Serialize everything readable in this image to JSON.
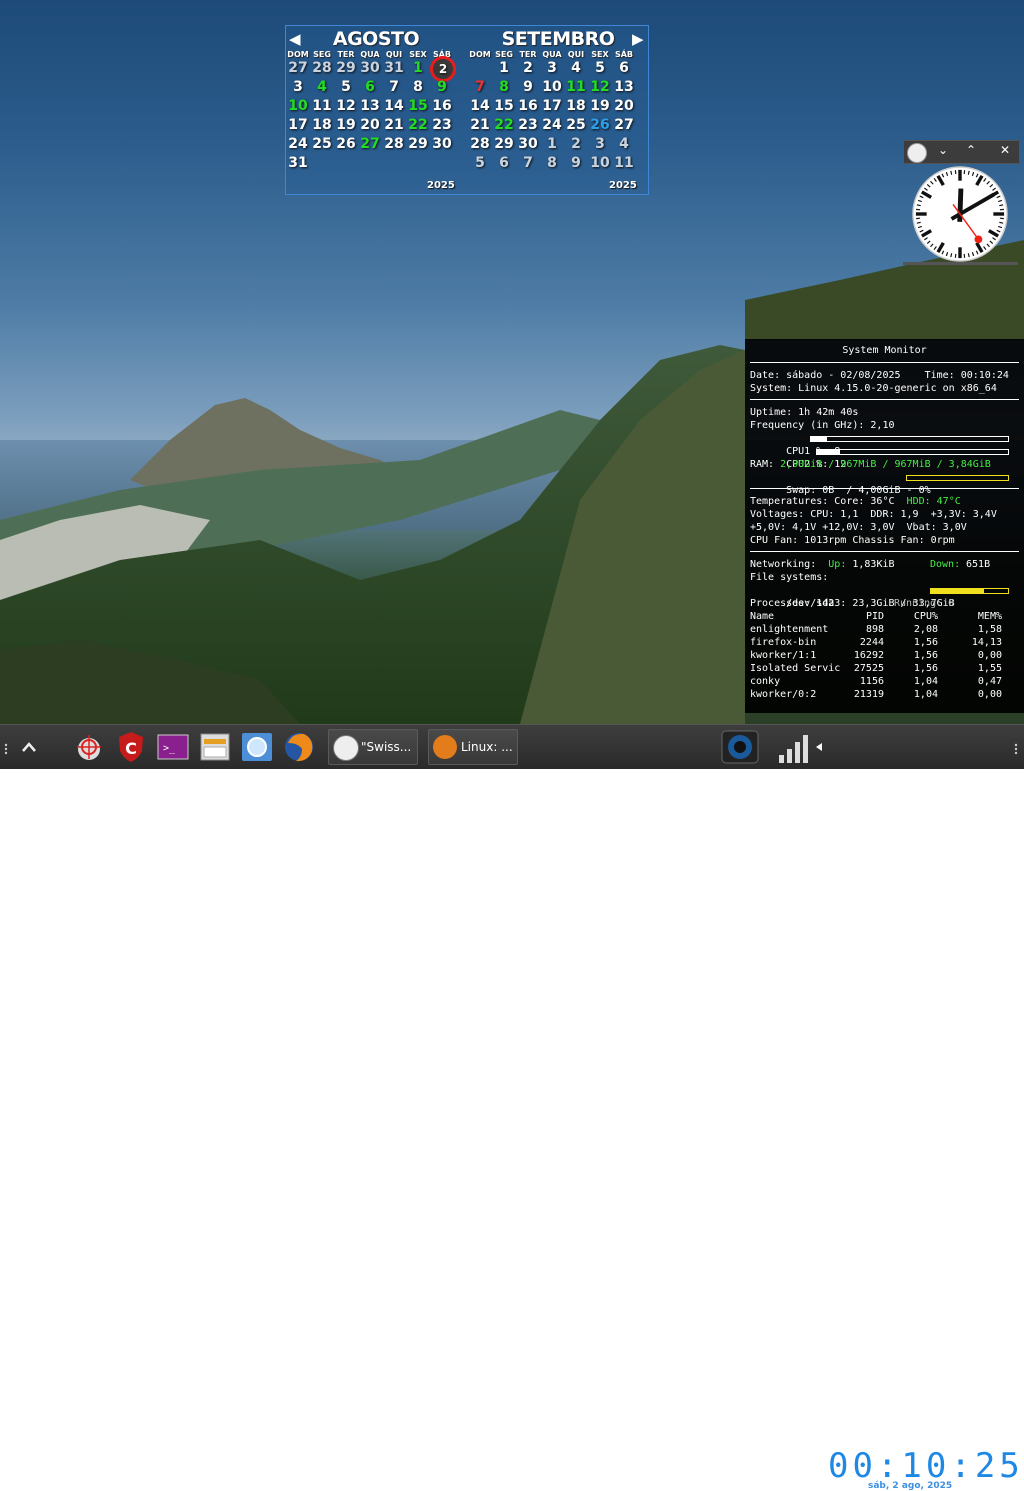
{
  "calendar": {
    "months": [
      {
        "name": "AGOSTO",
        "year": "2025",
        "weekdays": [
          "DOM",
          "SEG",
          "TER",
          "QUA",
          "QUI",
          "SEX",
          "SÁB"
        ],
        "weeks": [
          [
            {
              "d": "27",
              "s": "other"
            },
            {
              "d": "28",
              "s": "other"
            },
            {
              "d": "29",
              "s": "other"
            },
            {
              "d": "30",
              "s": "other"
            },
            {
              "d": "31",
              "s": "other"
            },
            {
              "d": "1",
              "s": "green"
            },
            {
              "d": "2",
              "s": "today"
            }
          ],
          [
            {
              "d": "3"
            },
            {
              "d": "4",
              "s": "green"
            },
            {
              "d": "5"
            },
            {
              "d": "6",
              "s": "green"
            },
            {
              "d": "7"
            },
            {
              "d": "8"
            },
            {
              "d": "9",
              "s": "green"
            }
          ],
          [
            {
              "d": "10",
              "s": "green"
            },
            {
              "d": "11"
            },
            {
              "d": "12"
            },
            {
              "d": "13"
            },
            {
              "d": "14"
            },
            {
              "d": "15",
              "s": "green"
            },
            {
              "d": "16"
            }
          ],
          [
            {
              "d": "17"
            },
            {
              "d": "18"
            },
            {
              "d": "19"
            },
            {
              "d": "20"
            },
            {
              "d": "21"
            },
            {
              "d": "22",
              "s": "green"
            },
            {
              "d": "23"
            }
          ],
          [
            {
              "d": "24"
            },
            {
              "d": "25"
            },
            {
              "d": "26"
            },
            {
              "d": "27",
              "s": "green"
            },
            {
              "d": "28"
            },
            {
              "d": "29"
            },
            {
              "d": "30"
            }
          ],
          [
            {
              "d": "31"
            },
            {
              "d": ""
            },
            {
              "d": ""
            },
            {
              "d": ""
            },
            {
              "d": ""
            },
            {
              "d": ""
            },
            {
              "d": ""
            }
          ]
        ]
      },
      {
        "name": "SETEMBRO",
        "year": "2025",
        "weekdays": [
          "DOM",
          "SEG",
          "TER",
          "QUA",
          "QUI",
          "SEX",
          "SÁB"
        ],
        "weeks": [
          [
            {
              "d": ""
            },
            {
              "d": "1"
            },
            {
              "d": "2"
            },
            {
              "d": "3"
            },
            {
              "d": "4"
            },
            {
              "d": "5"
            },
            {
              "d": "6"
            }
          ],
          [
            {
              "d": "7",
              "s": "red"
            },
            {
              "d": "8",
              "s": "green"
            },
            {
              "d": "9"
            },
            {
              "d": "10"
            },
            {
              "d": "11",
              "s": "green"
            },
            {
              "d": "12",
              "s": "green"
            },
            {
              "d": "13"
            }
          ],
          [
            {
              "d": "14"
            },
            {
              "d": "15"
            },
            {
              "d": "16"
            },
            {
              "d": "17"
            },
            {
              "d": "18"
            },
            {
              "d": "19"
            },
            {
              "d": "20"
            }
          ],
          [
            {
              "d": "21"
            },
            {
              "d": "22",
              "s": "green"
            },
            {
              "d": "23"
            },
            {
              "d": "24"
            },
            {
              "d": "25"
            },
            {
              "d": "26",
              "s": "blue"
            },
            {
              "d": "27"
            }
          ],
          [
            {
              "d": "28"
            },
            {
              "d": "29"
            },
            {
              "d": "30"
            },
            {
              "d": "1",
              "s": "other"
            },
            {
              "d": "2",
              "s": "other"
            },
            {
              "d": "3",
              "s": "other"
            },
            {
              "d": "4",
              "s": "other"
            }
          ],
          [
            {
              "d": "5",
              "s": "other"
            },
            {
              "d": "6",
              "s": "other"
            },
            {
              "d": "7",
              "s": "other"
            },
            {
              "d": "8",
              "s": "other"
            },
            {
              "d": "9",
              "s": "other"
            },
            {
              "d": "10",
              "s": "other"
            },
            {
              "d": "11",
              "s": "other"
            }
          ]
        ]
      }
    ]
  },
  "clock_widget": {
    "close_glyph": "✕",
    "minimize_glyph": "⌄",
    "maximize_glyph": "⌃",
    "hour_angle": 2,
    "minute_angle": 60,
    "second_angle": 144
  },
  "system_monitor": {
    "title": "System Monitor",
    "date_line": "Date: sábado - 02/08/2025    Time: 00:10:24",
    "system_line": "System: Linux 4.15.0-20-generic on x86_64",
    "uptime": "Uptime: 1h 42m 40s",
    "frequency": "Frequency (in GHz): 2,10",
    "cpu1": "CPU1 %: 8",
    "cpu1_fraction": 0.08,
    "cpu2": "CPU2 %: 12",
    "cpu2_fraction": 0.12,
    "ram_label": "RAM: ",
    "ram_value": "2,90GiB / 967MiB / 967MiB / 3,84GiB",
    "swap": "Swap: 0B  / 4,00GiB - 0%",
    "swap_fraction": 0.0,
    "temps_label": "Temperatures: Core: 36°C  ",
    "temps_hdd": "HDD: 47°C",
    "voltages1": "Voltages: CPU: 1,1  DDR: 1,9  +3,3V: 3,4V",
    "voltages2": "+5,0V: 4,1V +12,0V: 3,0V  Vbat: 3,0V",
    "fans": "CPU Fan: 1013rpm Chassis Fan: 0rpm",
    "net_label": "Networking:  ",
    "net_up_label": "Up:",
    "net_up_value": " 1,83KiB",
    "net_down_label": "Down:",
    "net_down_value": " 651B",
    "fs_label": "File systems:",
    "fs_value": "/dev/sda3: 23,3GiB / 33,7GiB",
    "fs_fraction": 0.69,
    "processes": "Processes: 142",
    "running": "Running: 0",
    "proc_headers": [
      "Name",
      "PID",
      "CPU%",
      "MEM%"
    ],
    "procs": [
      [
        "enlightenment",
        "898",
        "2,08",
        "1,58"
      ],
      [
        "firefox-bin",
        "2244",
        "1,56",
        "14,13"
      ],
      [
        "kworker/1:1",
        "16292",
        "1,56",
        "0,00"
      ],
      [
        "Isolated Servic",
        "27525",
        "1,56",
        "1,55"
      ],
      [
        "conky",
        "1156",
        "1,04",
        "0,47"
      ],
      [
        "kworker/0:2",
        "21319",
        "1,04",
        "0,00"
      ]
    ]
  },
  "taskbar": {
    "tasks": [
      {
        "label": "\"Swiss..."
      },
      {
        "label": "Linux: ..."
      }
    ],
    "clock_digits": "00:10:25",
    "date": "sáb, 2 ago, 2025"
  }
}
